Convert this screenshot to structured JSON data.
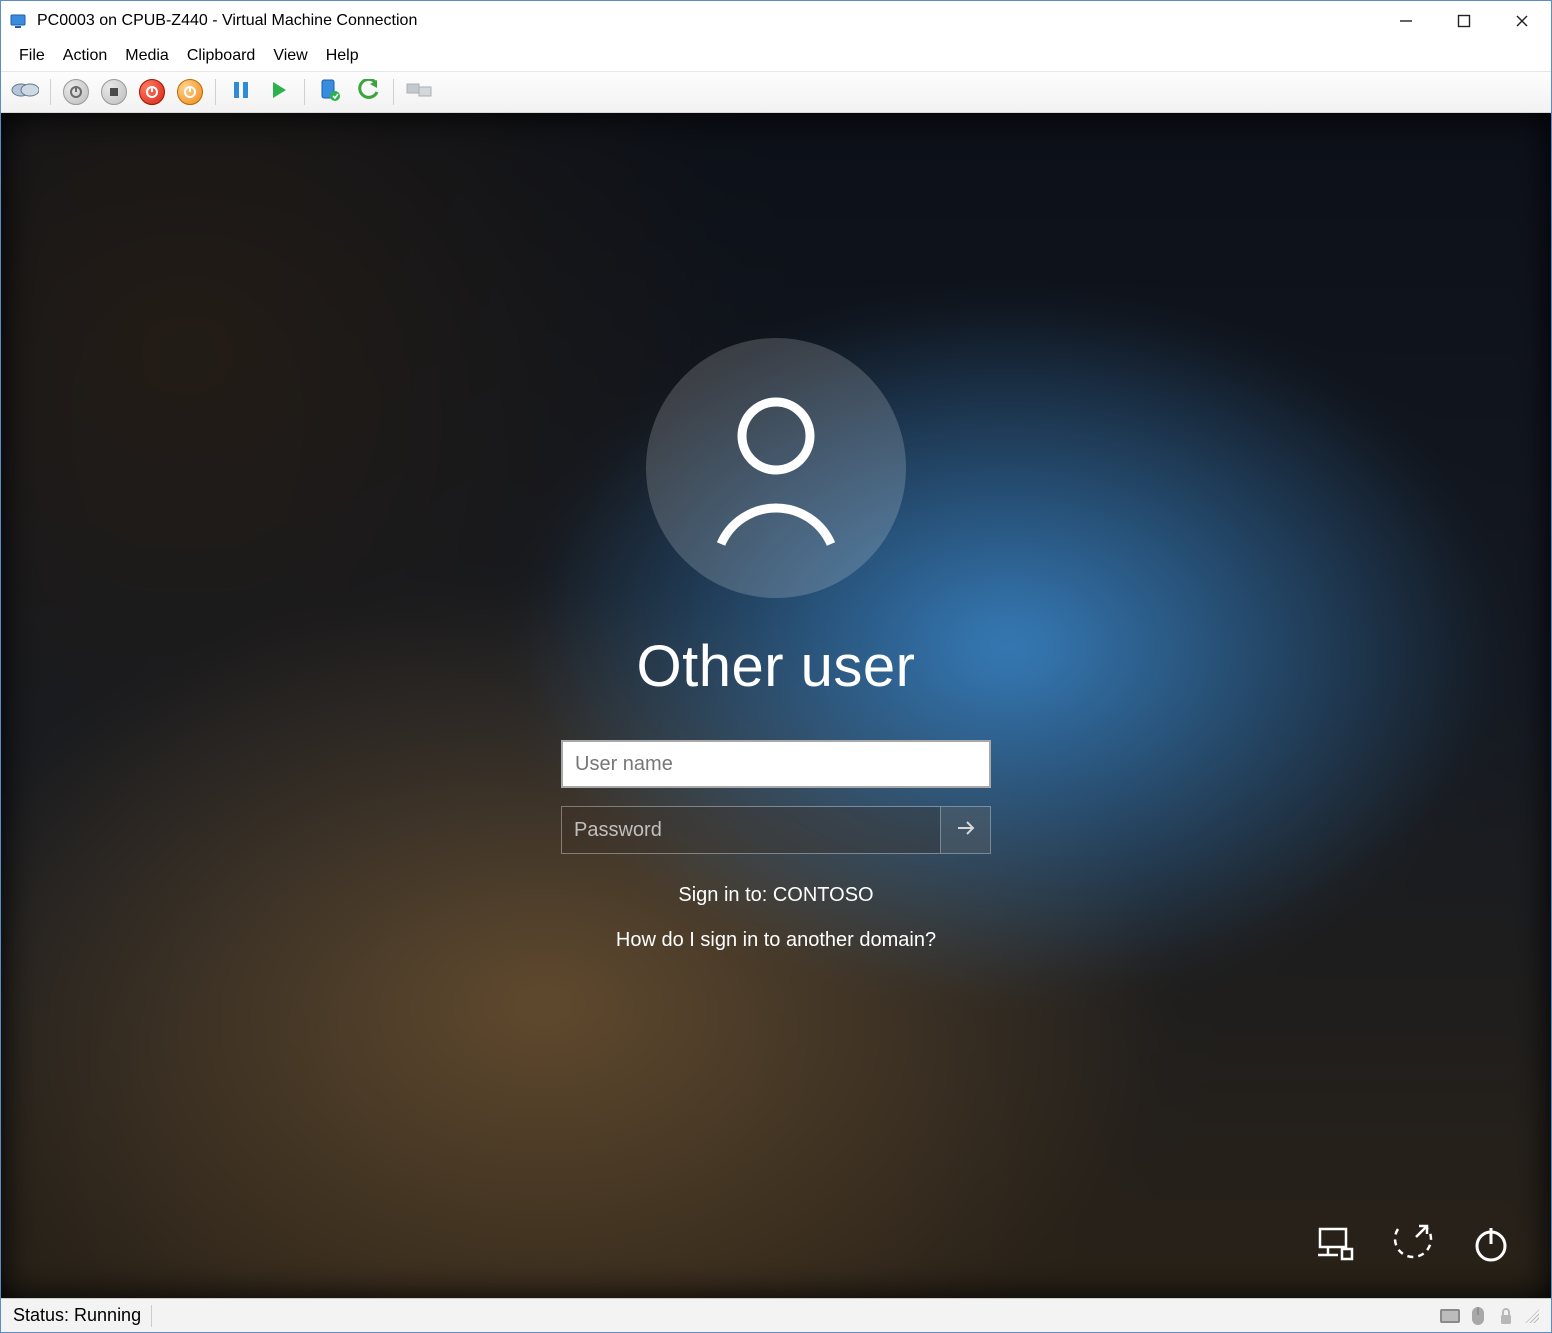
{
  "window": {
    "title": "PC0003 on CPUB-Z440 - Virtual Machine Connection"
  },
  "menubar": {
    "items": [
      "File",
      "Action",
      "Media",
      "Clipboard",
      "View",
      "Help"
    ]
  },
  "toolbar": {
    "icons": {
      "ctrl_alt_del": "ctrl-alt-del-icon",
      "turn_off": "turn-off-icon",
      "shut_down": "shut-down-icon",
      "save": "save-state-icon",
      "pause": "pause-icon",
      "start": "start-icon",
      "reset": "reset-icon",
      "checkpoint": "checkpoint-icon",
      "revert": "revert-icon",
      "share": "share-icon"
    }
  },
  "login": {
    "heading": "Other user",
    "username_placeholder": "User name",
    "password_placeholder": "Password",
    "sign_in_to": "Sign in to: CONTOSO",
    "domain_hint": "How do I sign in to another domain?"
  },
  "corner": {
    "network": "network-icon",
    "ease": "ease-of-access-icon",
    "power": "power-icon"
  },
  "statusbar": {
    "text": "Status: Running",
    "icons": {
      "keyboard": "keyboard-indicator-icon",
      "mouse": "mouse-indicator-icon",
      "lock": "security-indicator-icon"
    }
  }
}
